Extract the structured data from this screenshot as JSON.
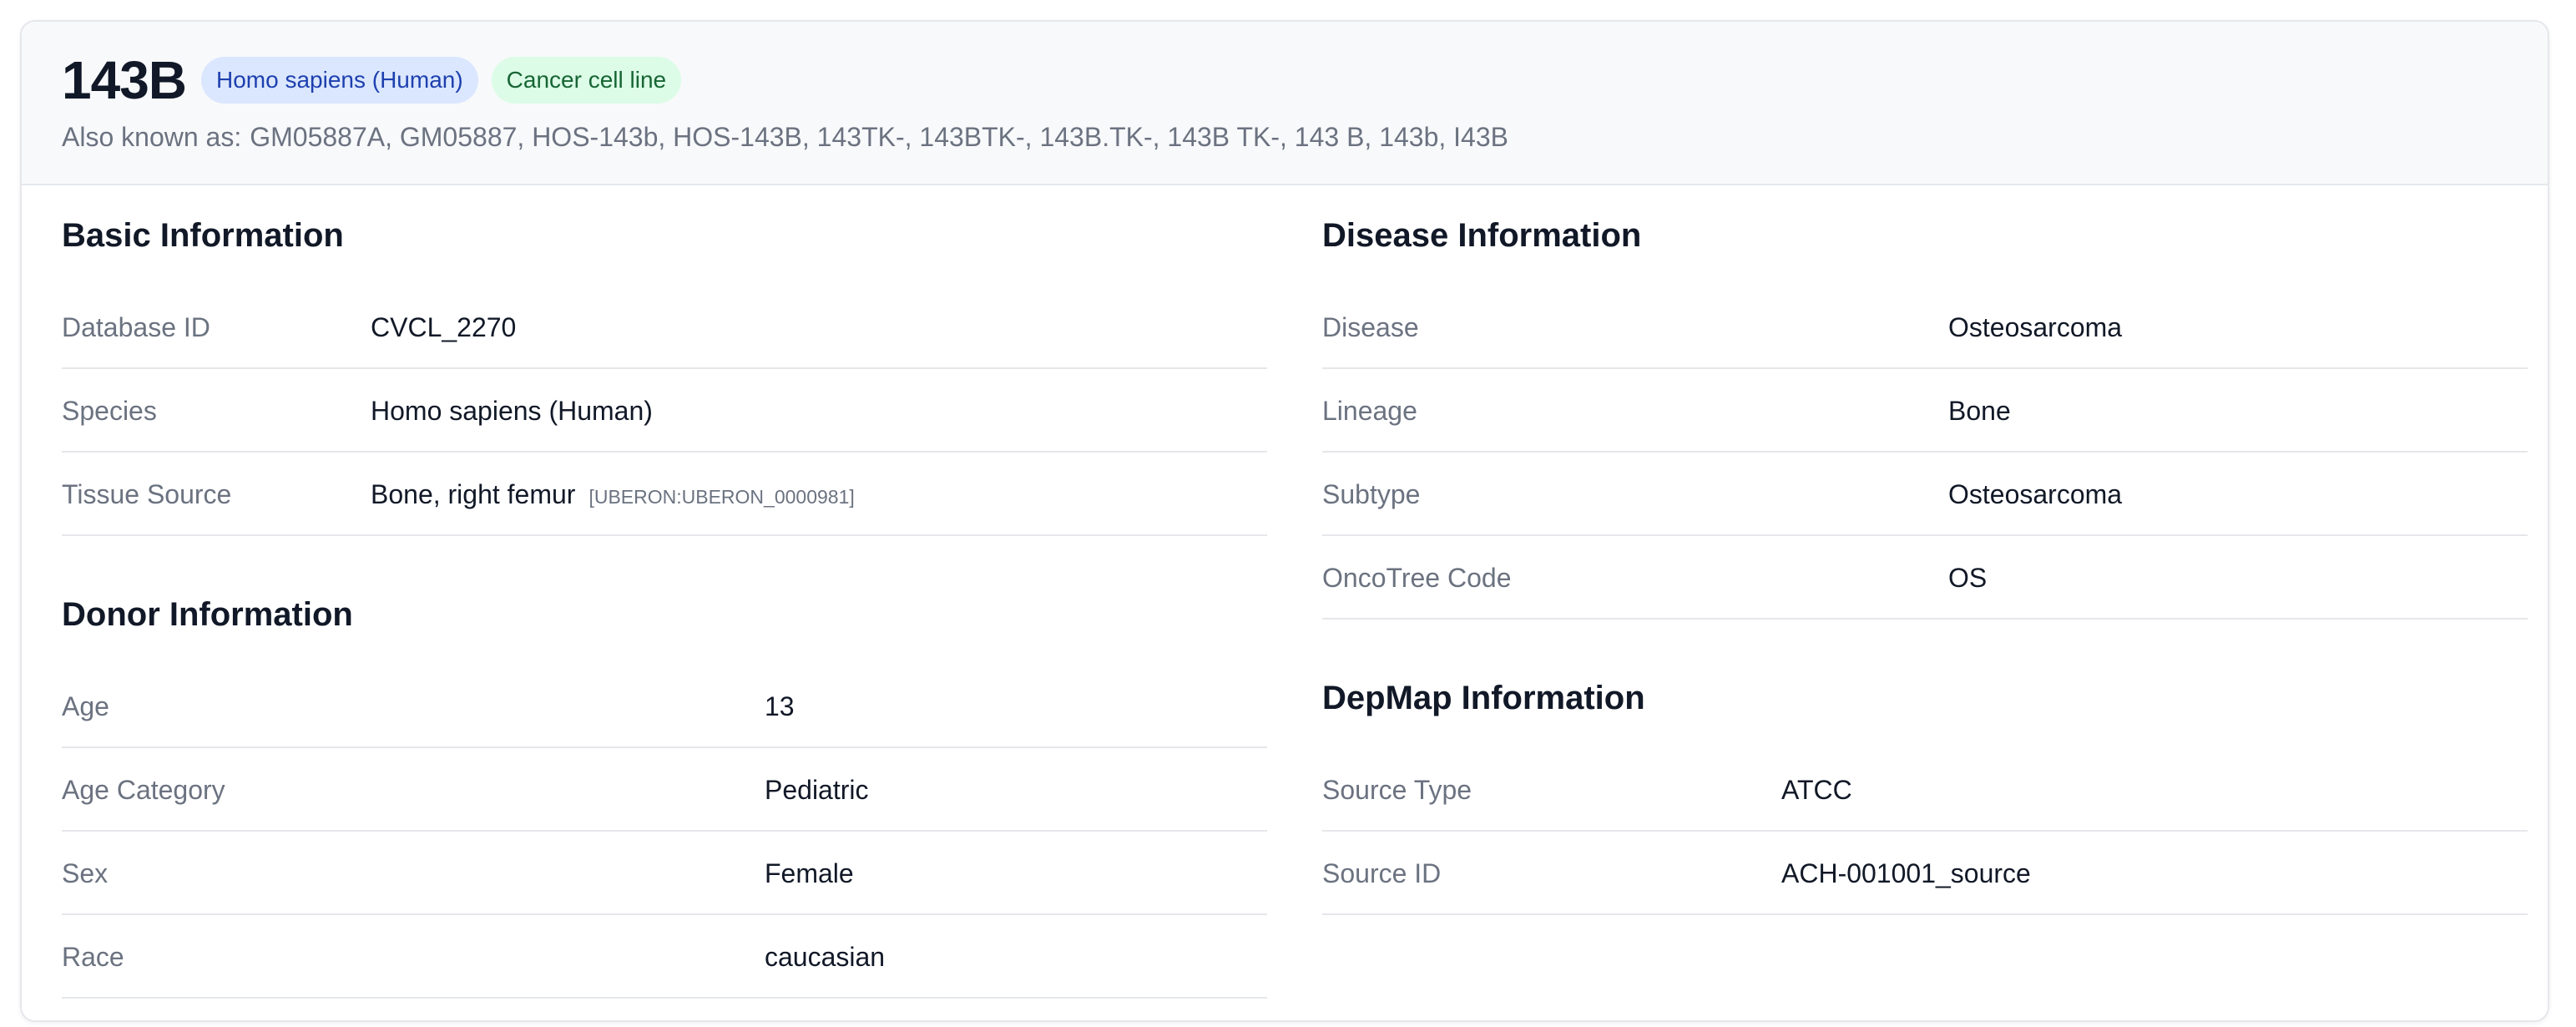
{
  "header": {
    "title": "143B",
    "badges": {
      "species": "Homo sapiens (Human)",
      "type": "Cancer cell line"
    },
    "aka_label": "Also known as:",
    "aka_values": "GM05887A, GM05887, HOS-143b, HOS-143B, 143TK-, 143BTK-, 143B.TK-, 143B TK-, 143 B, 143b, I43B"
  },
  "basic": {
    "title": "Basic Information",
    "rows": [
      {
        "label": "Database ID",
        "value": "CVCL_2270"
      },
      {
        "label": "Species",
        "value": "Homo sapiens (Human)"
      },
      {
        "label": "Tissue Source",
        "value": "Bone, right femur",
        "ref": "[UBERON:UBERON_0000981]"
      }
    ]
  },
  "donor": {
    "title": "Donor Information",
    "rows": [
      {
        "label": "Age",
        "value": "13"
      },
      {
        "label": "Age Category",
        "value": "Pediatric"
      },
      {
        "label": "Sex",
        "value": "Female"
      },
      {
        "label": "Race",
        "value": "caucasian"
      }
    ]
  },
  "disease": {
    "title": "Disease Information",
    "rows": [
      {
        "label": "Disease",
        "value": "Osteosarcoma"
      },
      {
        "label": "Lineage",
        "value": "Bone"
      },
      {
        "label": "Subtype",
        "value": "Osteosarcoma"
      },
      {
        "label": "OncoTree Code",
        "value": "OS"
      }
    ]
  },
  "depmap": {
    "title": "DepMap Information",
    "rows": [
      {
        "label": "Source Type",
        "value": "ATCC"
      },
      {
        "label": "Source ID",
        "value": "ACH-001001_source"
      }
    ]
  }
}
